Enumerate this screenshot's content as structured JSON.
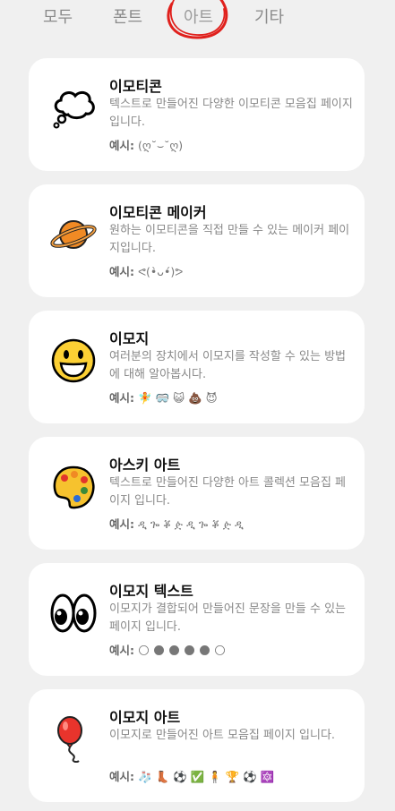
{
  "tabs": [
    {
      "label": "모두"
    },
    {
      "label": "폰트"
    },
    {
      "label": "아트"
    },
    {
      "label": "기타"
    }
  ],
  "example_prefix": "예시:",
  "cards": [
    {
      "title": "이모티콘",
      "desc": "텍스트로 만들어진 다양한 이모티콘 모음집 페이지 입니다.",
      "example": "(ღ˘⌣˘ღ)",
      "icon": "thought-bubble-icon"
    },
    {
      "title": "이모티콘 메이커",
      "desc": "원하는 이모티콘을 직접 만들 수 있는 메이커 페이지입니다.",
      "example": "ᕙ(•̀ᴗ•́)ᕗ",
      "icon": "ringed-planet-icon"
    },
    {
      "title": "이모지",
      "desc": "여러분의 장치에서 이모지를 작성할 수 있는 방법에 대해 알아봅시다.",
      "example": "🧚 🥽 😺 💩 😈",
      "icon": "grinning-face-icon"
    },
    {
      "title": "아스키 아트",
      "desc": "텍스트로 만들어진 다양한 아트 콜렉션 모음집 페이지 입니다.",
      "example": "ዲ ጐ ቖ ዽ ዲ ጐ ቖ ዽ ዲ",
      "icon": "artist-palette-icon"
    },
    {
      "title": "이모지 텍스트",
      "desc": "이모지가 결합되어 만들어진 문장을 만들 수 있는 페이지 입니다.",
      "example": "🌕 🌑 🌑 🌑 🌑 🌕",
      "icon": "eyes-icon"
    },
    {
      "title": "이모지 아트",
      "desc": "이모지로 만들어진 아트 모음집 페이지 입니다.",
      "example": "🧦 👢 ⚽ ✅ 🧍 🏆 ⚽ 🔯",
      "icon": "balloon-icon"
    }
  ]
}
